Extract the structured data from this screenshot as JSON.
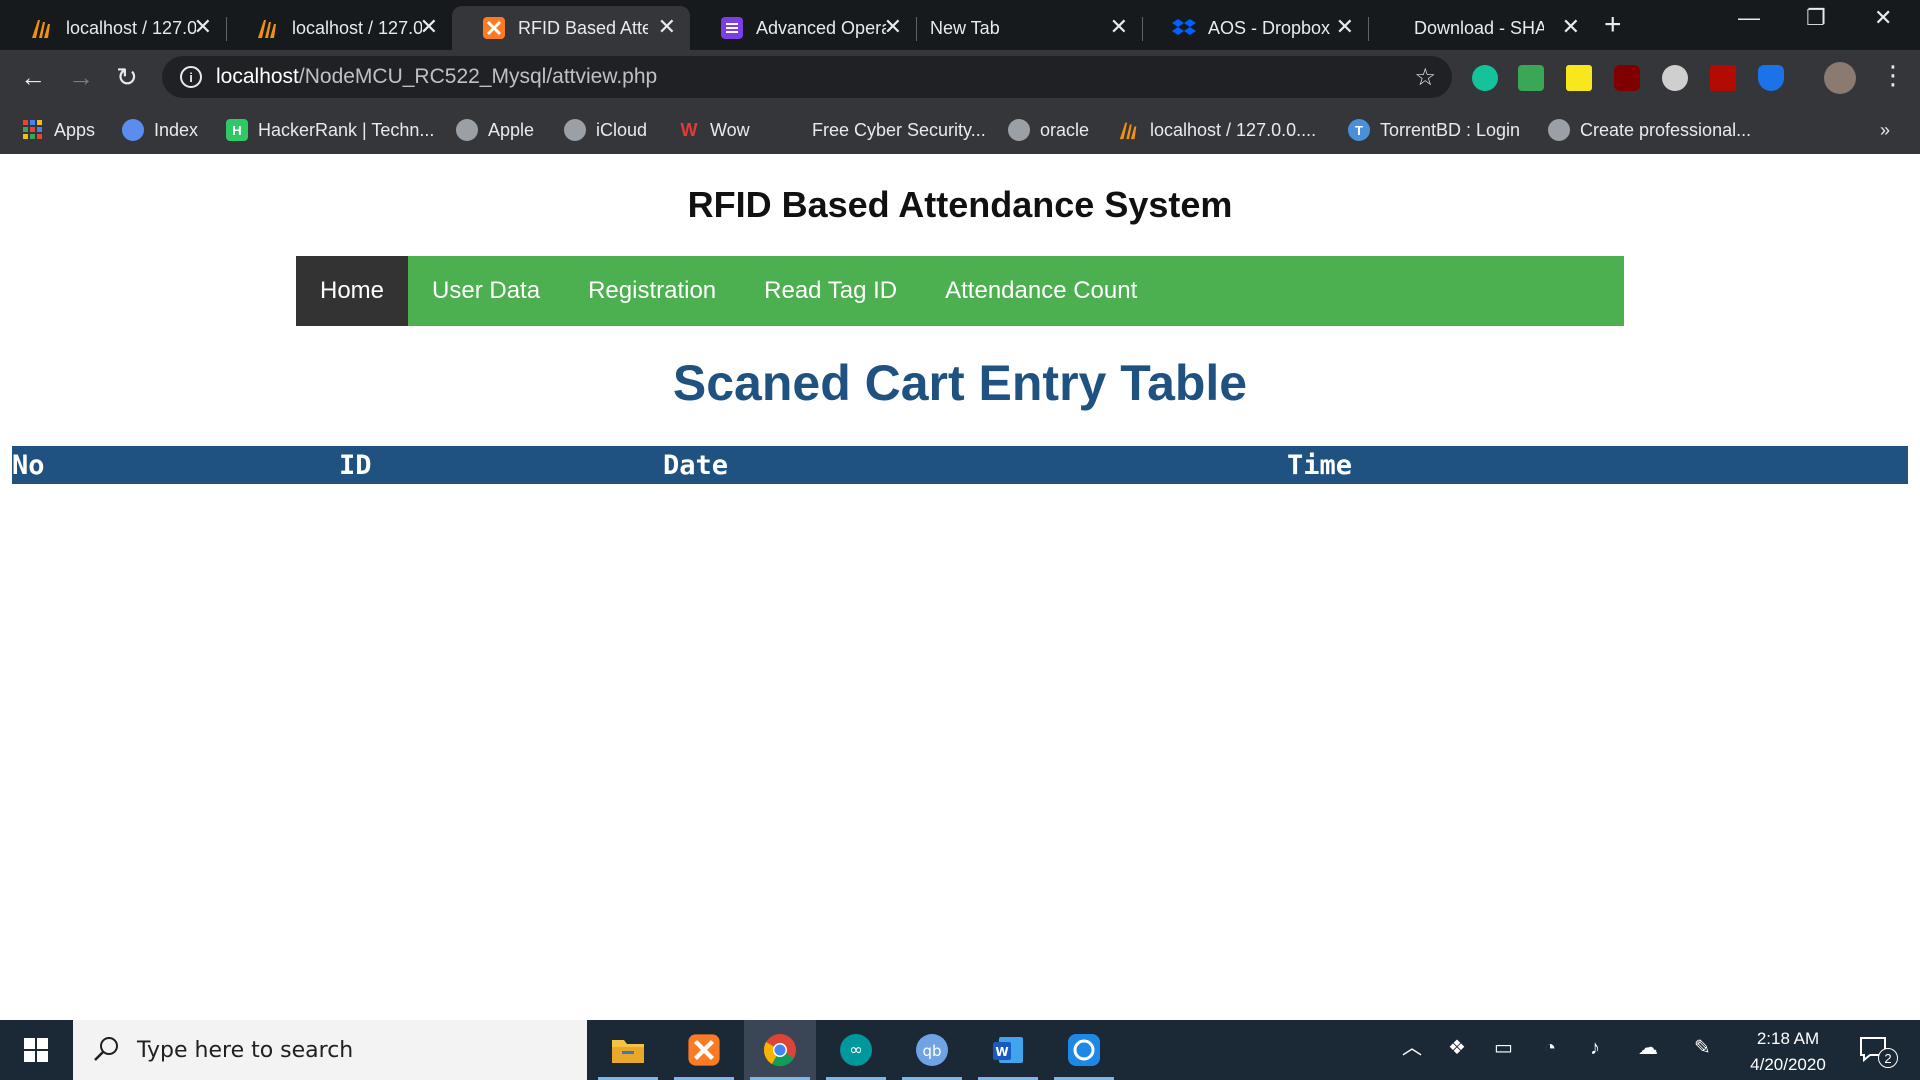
{
  "browser": {
    "tabs": [
      {
        "title": "localhost / 127.0",
        "icon": "phpmyadmin-icon",
        "active": false
      },
      {
        "title": "localhost / 127.0",
        "icon": "phpmyadmin-icon",
        "active": false
      },
      {
        "title": "RFID Based Atte",
        "icon": "xampp-icon",
        "active": true
      },
      {
        "title": "Advanced Opera",
        "icon": "list-icon",
        "active": false
      },
      {
        "title": "New Tab",
        "icon": "",
        "active": false
      },
      {
        "title": "AOS - Dropbox",
        "icon": "dropbox-icon",
        "active": false
      },
      {
        "title": "Download - SHA",
        "icon": "",
        "active": false
      }
    ],
    "url_host": "localhost",
    "url_path": "/NodeMCU_RC522_Mysql/attview.php",
    "bookmarks": [
      {
        "label": "Apps",
        "icon": "apps-grid-icon"
      },
      {
        "label": "Index",
        "icon": "index-icon"
      },
      {
        "label": "HackerRank | Techn...",
        "icon": "hackerrank-icon"
      },
      {
        "label": "Apple",
        "icon": "apple-icon"
      },
      {
        "label": "iCloud",
        "icon": "globe-icon"
      },
      {
        "label": "Wow",
        "icon": "wow-icon"
      },
      {
        "label": "Free Cyber Security...",
        "icon": ""
      },
      {
        "label": "oracle",
        "icon": "globe-icon"
      },
      {
        "label": "localhost / 127.0.0....",
        "icon": "phpmyadmin-icon"
      },
      {
        "label": "TorrentBD : Login",
        "icon": "torrentbd-icon"
      },
      {
        "label": "Create professional...",
        "icon": "globe-icon"
      }
    ],
    "more_bookmarks": "»"
  },
  "page": {
    "site_title": "RFID Based Attendance System",
    "nav": [
      {
        "label": "Home",
        "active": true
      },
      {
        "label": "User Data",
        "active": false
      },
      {
        "label": "Registration",
        "active": false
      },
      {
        "label": "Read Tag ID",
        "active": false
      },
      {
        "label": "Attendance Count",
        "active": false
      }
    ],
    "table_heading": "Scaned Cart Entry Table",
    "table_columns": [
      "No",
      "ID",
      "Date",
      "Time"
    ],
    "table_rows": []
  },
  "taskbar": {
    "search_placeholder": "Type here to search",
    "time": "2:18 AM",
    "date": "4/20/2020",
    "notification_count": "2"
  },
  "colors": {
    "nav_green": "#4caf50",
    "nav_active": "#333333",
    "heading_blue": "#1f5280"
  }
}
